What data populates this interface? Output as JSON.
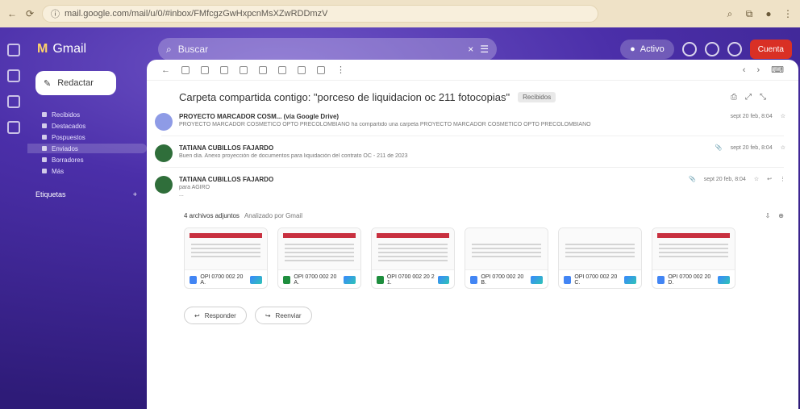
{
  "browser": {
    "url": "mail.google.com/mail/u/0/#inbox/FMfcgzGwHxpcnMsXZwRDDmzV"
  },
  "gmail": {
    "logo_text": "Gmail",
    "search_placeholder": "Buscar",
    "status_chip": "Activo",
    "compose_label": "Redactar",
    "nav_items": [
      "Recibidos",
      "Destacados",
      "Pospuestos",
      "Enviados",
      "Borradores",
      "Más"
    ],
    "labels_title": "Etiquetas",
    "red_button_label": "Cuenta"
  },
  "email": {
    "subject": "Carpeta compartida contigo: \"porceso de liquidacion oc 211 fotocopias\"",
    "subject_tag": "Recibidos",
    "messages": [
      {
        "sender": "PROYECTO MARCADOR COSM... (vía Google Drive)",
        "snippet": "PROYECTO MARCADOR COSMETICO OPTO PRECOLOMBIANO ha compartido una carpeta PROYECTO MARCADOR COSMETICO OPTO PRECOLOMBIANO",
        "time": "sept 20 feb, 8:04"
      },
      {
        "sender": "TATIANA CUBILLOS FAJARDO",
        "snippet": "Buen día. Anexo proyección de documentos para liquidación del contrato OC - 211 de 2023",
        "time": "sept 20 feb, 8:04"
      },
      {
        "sender": "TATIANA CUBILLOS FAJARDO",
        "to": "para AGIRO",
        "snippet": "...",
        "time": "sept 20 feb, 8:04"
      }
    ],
    "attachments_title": "4 archivos adjuntos",
    "attachments_meta": "Analizado por Gmail",
    "attachments": [
      {
        "name": "OPI 0700 002 20 A.",
        "type": "doc"
      },
      {
        "name": "OPI 0700 002 20 A.",
        "type": "sheet"
      },
      {
        "name": "OPI 0700 002 20 2 1.",
        "type": "sheet"
      },
      {
        "name": "OPI 0700 002 20 B.",
        "type": "doc"
      },
      {
        "name": "OPI 0700 002 20 C.",
        "type": "doc"
      },
      {
        "name": "OPI 0700 002 20 D.",
        "type": "doc"
      }
    ],
    "actions": {
      "reply": "Responder",
      "forward": "Reenviar"
    }
  },
  "colors": {
    "gmail_purple": "#4b2fa9",
    "attachment_red": "#c21a2a",
    "drive_blue": "#3a86ff"
  }
}
